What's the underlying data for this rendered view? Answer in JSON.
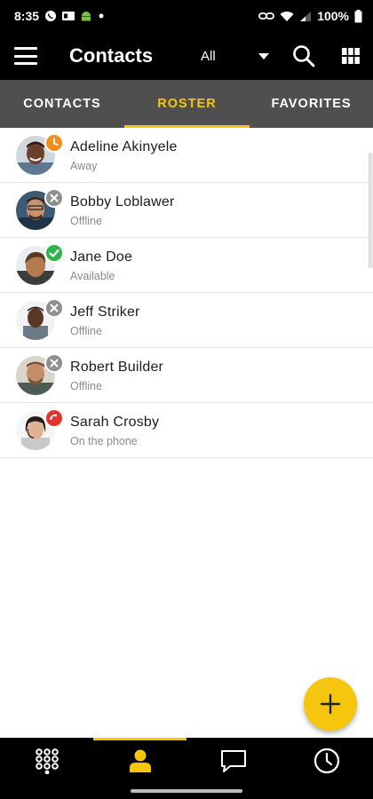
{
  "status_bar": {
    "time": "8:35",
    "battery_text": "100%",
    "icons": [
      "whatsapp-icon",
      "sim-icon",
      "android-icon",
      "dot-icon",
      "link-icon",
      "wifi-icon",
      "signal-icon",
      "battery-icon"
    ]
  },
  "app_bar": {
    "title": "Contacts",
    "filter_value": "All",
    "icons": [
      "menu-icon",
      "dropdown-caret-icon",
      "search-icon",
      "grid-icon"
    ]
  },
  "tabs": [
    {
      "label": "CONTACTS",
      "active": false
    },
    {
      "label": "ROSTER",
      "active": true
    },
    {
      "label": "FAVORITES",
      "active": false
    }
  ],
  "contacts": [
    {
      "name": "Adeline Akinyele",
      "status": "Away",
      "presence": "away",
      "presence_color": "#f28c1c"
    },
    {
      "name": "Bobby Loblawer",
      "status": "Offline",
      "presence": "offline",
      "presence_color": "#8f8f8f"
    },
    {
      "name": "Jane Doe",
      "status": "Available",
      "presence": "available",
      "presence_color": "#2db34a"
    },
    {
      "name": "Jeff Striker",
      "status": "Offline",
      "presence": "offline",
      "presence_color": "#8f8f8f"
    },
    {
      "name": "Robert Builder",
      "status": "Offline",
      "presence": "offline",
      "presence_color": "#8f8f8f"
    },
    {
      "name": "Sarah Crosby",
      "status": "On the phone",
      "presence": "on-phone",
      "presence_color": "#e5322d"
    }
  ],
  "fab": {
    "icon": "plus-icon",
    "color": "#f6c60f"
  },
  "bottom_nav": [
    {
      "icon": "dialpad-icon",
      "active": false
    },
    {
      "icon": "contacts-person-icon",
      "active": true
    },
    {
      "icon": "chat-icon",
      "active": false
    },
    {
      "icon": "history-clock-icon",
      "active": false
    }
  ],
  "colors": {
    "accent": "#f6c60f",
    "app_bar_bg": "#000000",
    "tabs_bg": "#4f4f4f"
  }
}
